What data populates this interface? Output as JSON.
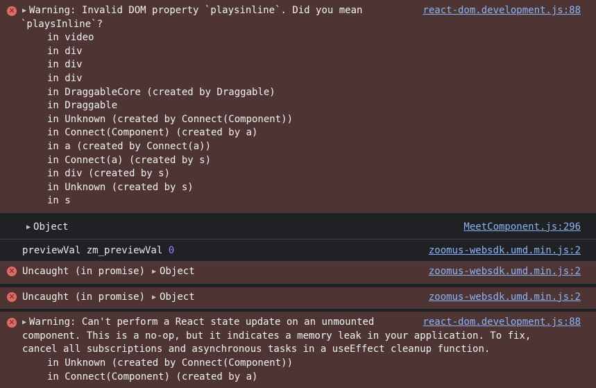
{
  "entries": {
    "e1": {
      "line1": "Warning: Invalid DOM property `playsinline`. Did you mean",
      "line2": "`playsInline`?",
      "source": "react-dom.development.js:88",
      "stack": [
        "in video",
        "in div",
        "in div",
        "in div",
        "in DraggableCore (created by Draggable)",
        "in Draggable",
        "in Unknown (created by Connect(Component))",
        "in Connect(Component) (created by a)",
        "in a (created by Connect(a))",
        "in Connect(a) (created by s)",
        "in div (created by s)",
        "in Unknown (created by s)",
        "in s"
      ]
    },
    "e2": {
      "text": "Object",
      "source": "MeetComponent.js:296"
    },
    "e3": {
      "text": "previewVal zm_previewVal",
      "value": "0",
      "source": "zoomus-websdk.umd.min.js:2"
    },
    "e4": {
      "text": "Uncaught (in promise)",
      "object": "Object",
      "source": "zoomus-websdk.umd.min.js:2"
    },
    "e5": {
      "text": "Uncaught (in promise)",
      "object": "Object",
      "source": "zoomus-websdk.umd.min.js:2"
    },
    "e6": {
      "line1": "Warning: Can't perform a React state update on an unmounted",
      "line2": "component. This is a no-op, but it indicates a memory leak in your application. To fix,",
      "line3": "cancel all subscriptions and asynchronous tasks in a useEffect cleanup function.",
      "source": "react-dom.development.js:88",
      "stack": [
        "in Unknown (created by Connect(Component))",
        "in Connect(Component) (created by a)"
      ]
    }
  },
  "icons": {
    "error": "error-icon",
    "expand": "expand-triangle-icon"
  },
  "colors": {
    "error_bg": "#4e3534",
    "link": "#8ab4f8",
    "number": "#9980ff",
    "icon_red": "#e46962"
  }
}
